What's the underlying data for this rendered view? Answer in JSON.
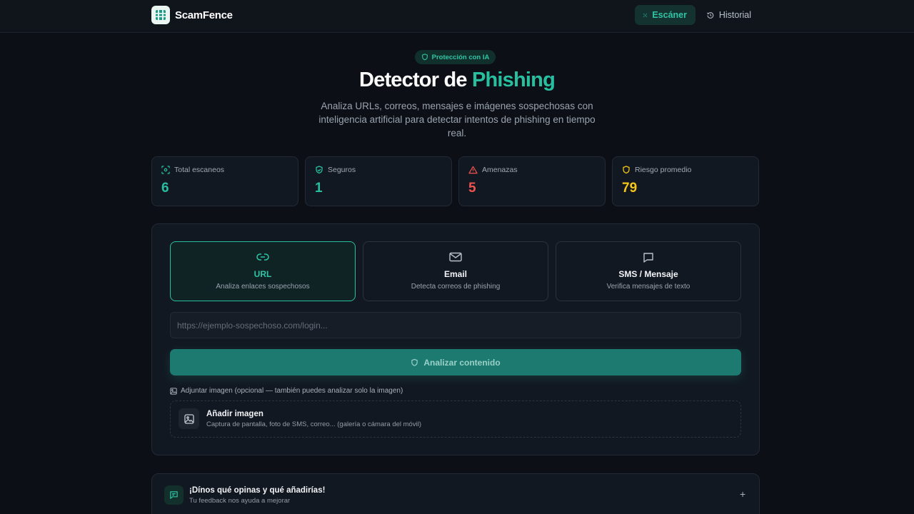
{
  "header": {
    "brand": "ScamFence",
    "nav": [
      {
        "label": "Escáner",
        "icon": "scan-icon",
        "active": true
      },
      {
        "label": "Historial",
        "icon": "history-icon",
        "active": false
      }
    ]
  },
  "hero": {
    "badge": "Protección con IA",
    "title_main": "Detector de ",
    "title_accent": "Phishing",
    "subtitle": "Analiza URLs, correos, mensajes e imágenes sospechosas con inteligencia artificial para detectar intentos de phishing en tiempo real."
  },
  "stats": [
    {
      "label": "Total escaneos",
      "value": "6",
      "color": "#27bfa0",
      "icon": "scan-icon"
    },
    {
      "label": "Seguros",
      "value": "1",
      "color": "#27bfa0",
      "icon": "shield-check-icon"
    },
    {
      "label": "Amenazas",
      "value": "5",
      "color": "#ef5350",
      "icon": "alert-triangle-icon"
    },
    {
      "label": "Riesgo promedio",
      "value": "79",
      "color": "#f5c518",
      "icon": "shield-icon"
    }
  ],
  "tabs": [
    {
      "label": "URL",
      "desc": "Analiza enlaces sospechosos",
      "icon": "link-icon",
      "active": true
    },
    {
      "label": "Email",
      "desc": "Detecta correos de phishing",
      "icon": "mail-icon",
      "active": false
    },
    {
      "label": "SMS / Mensaje",
      "desc": "Verifica mensajes de texto",
      "icon": "message-icon",
      "active": false
    }
  ],
  "input": {
    "placeholder": "https://ejemplo-sospechoso.com/login...",
    "value": ""
  },
  "analyze_label": "Analizar contenido",
  "attach": {
    "label": "Adjuntar imagen (opcional — también puedes analizar solo la imagen)",
    "title": "Añadir imagen",
    "desc": "Captura de pantalla, foto de SMS, correo... (galería o cámara del móvil)"
  },
  "feedback": {
    "title": "¡Dínos qué opinas y qué añadirías!",
    "subtitle": "Tu feedback nos ayuda a mejorar",
    "toggle": "+"
  },
  "colors": {
    "accent": "#27bfa0",
    "danger": "#ef5350",
    "warning": "#f5c518",
    "background": "#0c1016",
    "card": "#121821"
  }
}
